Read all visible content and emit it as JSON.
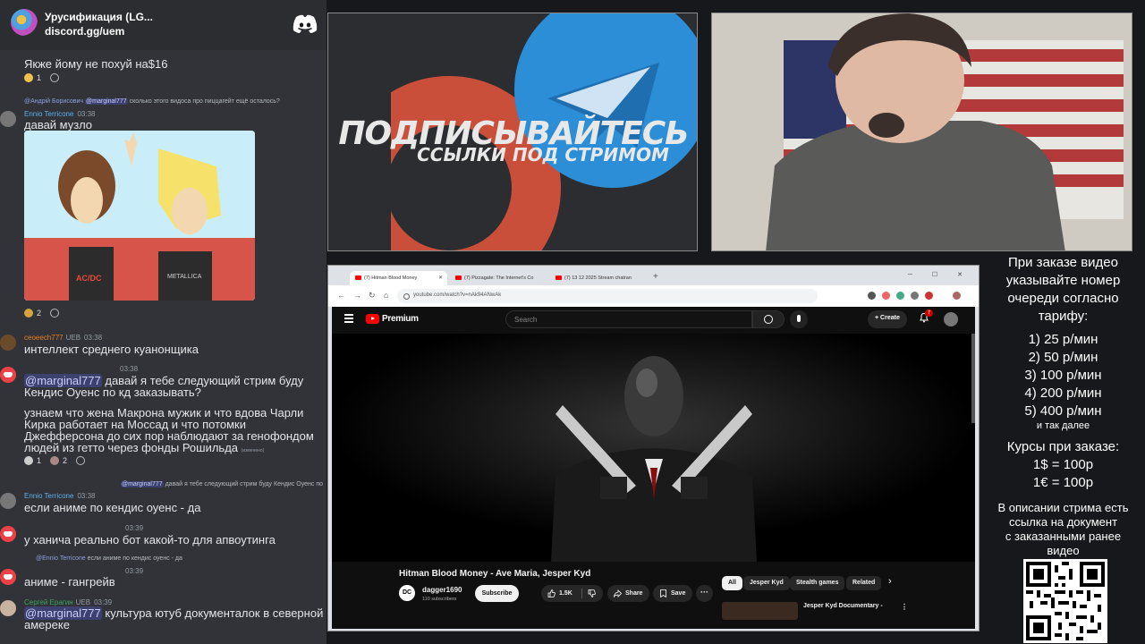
{
  "discord": {
    "server_name": "Урусификация (LG...",
    "server_link": "discord.gg/uem",
    "messages": {
      "m1_text": "Якже йому не похуй на$16",
      "m1_reaction_count": "1",
      "m2_reply_author": "@Андрій Борисович",
      "m2_reply_mention": "@marginal777",
      "m2_reply_text": "сколько этого видоса про пиццагейт ещё осталось?",
      "m2_author": "Ennio Terricone",
      "m2_time": "03:38",
      "m2_text": "давай музло",
      "m2_reaction_count": "2",
      "m3_author": "ceoeech777",
      "m3_badge": "UEB",
      "m3_time": "03:38",
      "m3_text": "интеллект среднего куанонщика",
      "m4_time": "03:38",
      "m4_mention": "@marginal777",
      "m4_text_a": " давай я тебе следующий стрим буду Кендис Оуенс по кд заказывать?",
      "m4_text_b": "узнаем что жена Макрона мужик и что вдова Чарли Кирка работает на Моссад и что потомки Джефферсона до сих пор наблюдают за генофондом людей из гетто через фонды Рошильда",
      "m4_edited": "(изменено)",
      "m4_reaction_1": "1",
      "m4_reaction_2": "2",
      "m5_reply_mention": "@marginal777",
      "m5_reply_text": "давай я тебе следующий стрим буду Кендис Оуенс по",
      "m5_author": "Ennio Terricone",
      "m5_time": "03:38",
      "m5_text": "если аниме по кендис оуенс - да",
      "m6_time": "03:39",
      "m6_text": "у ханича реально бот какой-то для апвоутинга",
      "m7_reply_author": "@Ennio Terricone",
      "m7_reply_text": "если аниме по кендис оуенс - да",
      "m7_time": "03:39",
      "m7_text": "аниме - гангрейв",
      "m8_author": "Сергей Ерагин",
      "m8_badge": "UEB",
      "m8_time": "03:39",
      "m8_mention": "@marginal777",
      "m8_text": " культура ютуб документалок в северной амереке"
    }
  },
  "banner": {
    "title": "ПОДПИСЫВАЙТЕСЬ",
    "subtitle": "ССЫЛКИ ПОД СТРИМОМ",
    "colors": {
      "patreon": "#c94f3a",
      "telegram": "#2b8ed6"
    }
  },
  "browser": {
    "tabs": [
      {
        "label": "(7) Hitman Blood Money"
      },
      {
        "label": "(7) Pizzagate: The Internet's Co"
      },
      {
        "label": "(7) 13 12 2025 Stream chatran"
      }
    ],
    "url": "youtube.com/watch?v=nAk94ANwAk",
    "youtube": {
      "logo": "Premium",
      "search_placeholder": "Search",
      "create_label": "Create",
      "notif_count": "7",
      "video_title": "Hitman Blood Money - Ave Maria, Jesper Kyd",
      "channel_name": "dagger1690",
      "channel_subs": "110 subscribers",
      "channel_initials": "DC",
      "subscribe_label": "Subscribe",
      "likes": "1.5K",
      "share_label": "Share",
      "save_label": "Save",
      "more_label": "···",
      "chips": [
        "All",
        "Jesper Kyd",
        "Stealth games",
        "Related"
      ],
      "rec_title": "Jesper Kyd Documentary -",
      "rec_menu": "⋮"
    }
  },
  "info": {
    "line1": "При заказе видео",
    "line2": "указывайте номер",
    "line3": "очереди согласно",
    "line4": "тарифу:",
    "tariffs": [
      "1) 25 р/мин",
      "2) 50 р/мин",
      "3) 100 р/мин",
      "4) 200 р/мин",
      "5) 400 р/мин"
    ],
    "etc": "и так далее",
    "rates_title": "Курсы при заказе:",
    "rate1": "1$ = 100р",
    "rate2": "1€ = 100р",
    "desc1": "В описании стрима есть",
    "desc2": "ссылка на документ",
    "desc3": "с заказанными ранее",
    "desc4": "видео"
  }
}
